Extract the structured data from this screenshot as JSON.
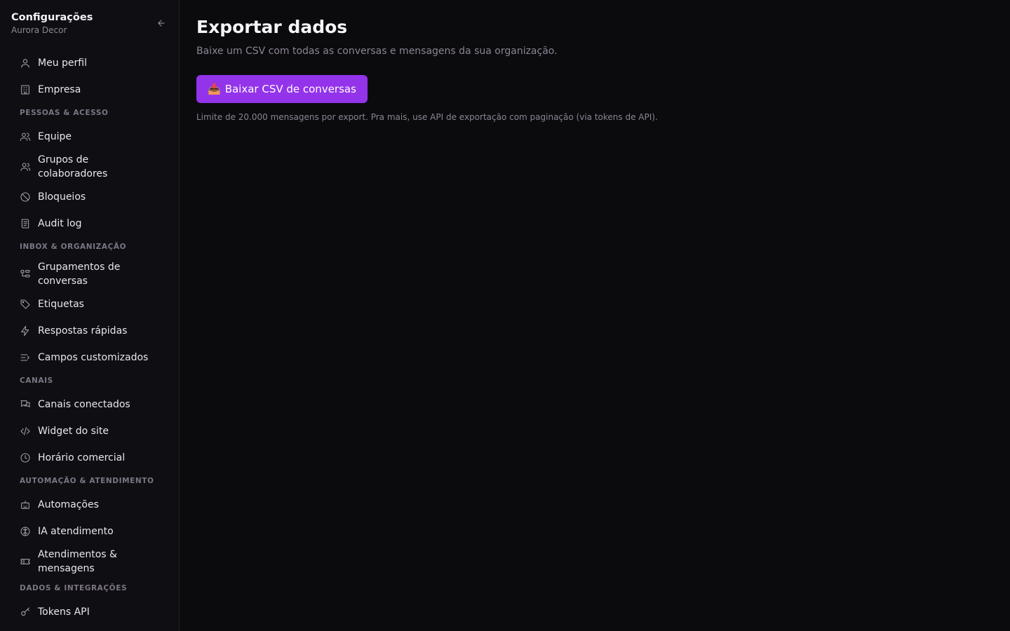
{
  "sidebar": {
    "title": "Configurações",
    "subtitle": "Aurora Decor",
    "items": {
      "profile": "Meu perfil",
      "company": "Empresa",
      "section_people": "PESSOAS & ACESSO",
      "team": "Equipe",
      "groups": "Grupos de colaboradores",
      "blocks": "Bloqueios",
      "audit": "Audit log",
      "section_inbox": "INBOX & ORGANIZAÇÃO",
      "groupings": "Grupamentos de conversas",
      "tags": "Etiquetas",
      "quick_replies": "Respostas rápidas",
      "custom_fields": "Campos customizados",
      "section_channels": "CANAIS",
      "connected_channels": "Canais conectados",
      "site_widget": "Widget do site",
      "business_hours": "Horário comercial",
      "section_automation": "AUTOMAÇÃO & ATENDIMENTO",
      "automations": "Automações",
      "ai_support": "IA atendimento",
      "tickets_messages": "Atendimentos & mensagens",
      "section_data": "DADOS & INTEGRAÇÕES",
      "api_tokens": "Tokens API"
    }
  },
  "main": {
    "title": "Exportar dados",
    "description": "Baixe um CSV com todas as conversas e mensagens da sua organização.",
    "button_emoji": "📥",
    "button_label": "Baixar CSV de conversas",
    "note": "Limite de 20.000 mensagens por export. Pra mais, use API de exportação com paginação (via tokens de API)."
  },
  "colors": {
    "accent": "#9333ea",
    "background": "#0b0a0d",
    "sidebar": "#0f0e12"
  },
  "icons": [
    "arrow-left-icon",
    "user-icon",
    "building-icon",
    "users-icon",
    "user-group-icon",
    "ban-icon",
    "receipt-icon",
    "split-icon",
    "tag-icon",
    "zap-icon",
    "list-icon",
    "chat-icon",
    "code-icon",
    "clock-icon",
    "bot-icon",
    "brain-icon",
    "ticket-icon",
    "key-icon"
  ]
}
